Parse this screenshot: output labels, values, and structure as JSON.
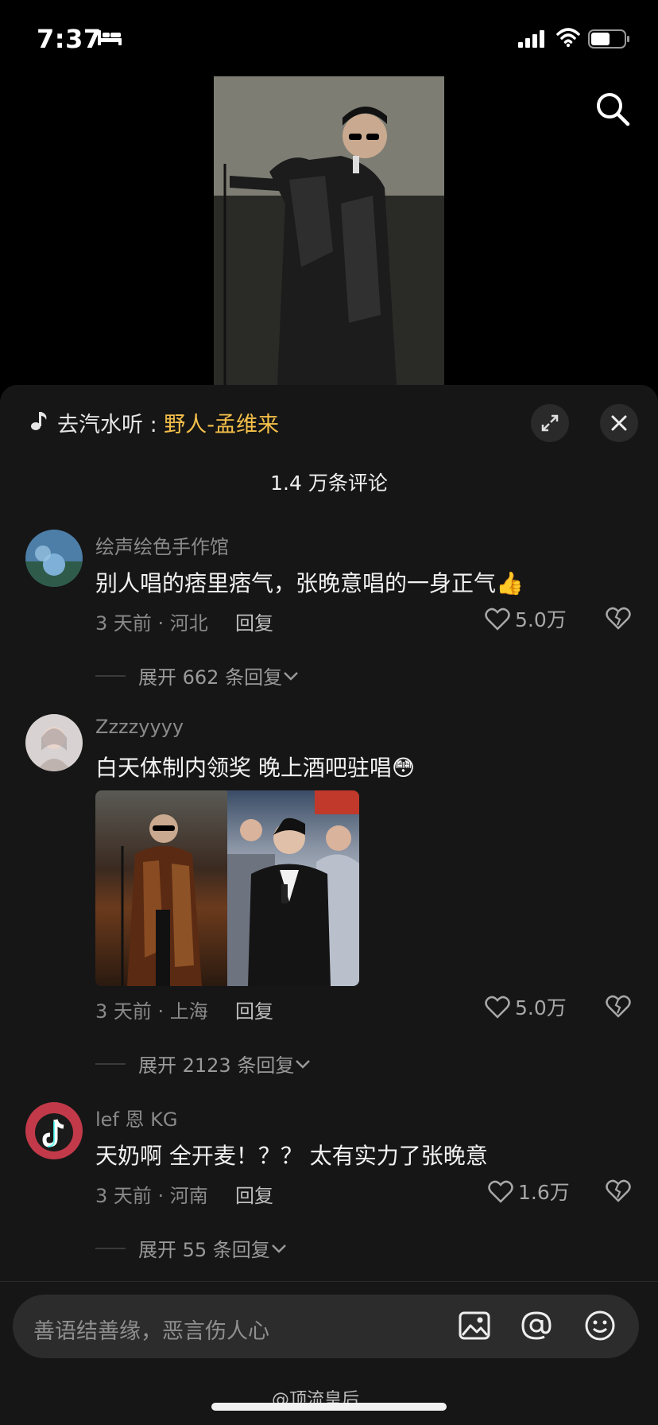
{
  "status_bar": {
    "time": "7:37"
  },
  "sheet": {
    "music": {
      "prefix": "去汽水听 : ",
      "song": "野人-孟维来"
    },
    "comment_count": "1.4 万条评论"
  },
  "comments": [
    {
      "username": "绘声绘色手作馆",
      "text": "别人唱的痞里痞气，张晚意唱的一身正气👍",
      "time_location": "3 天前 · 河北",
      "reply_label": "回复",
      "likes": "5.0万",
      "expand": "展开 662 条回复"
    },
    {
      "username": "Zzzzyyyy",
      "text": "白天体制内领奖 晚上酒吧驻唱😳",
      "time_location": "3 天前 · 上海",
      "reply_label": "回复",
      "likes": "5.0万",
      "expand": "展开 2123 条回复"
    },
    {
      "username": "lef 恩 KG",
      "text": "天奶啊 全开麦！？？ 太有实力了张晚意",
      "time_location": "3 天前 · 河南",
      "reply_label": "回复",
      "likes": "1.6万",
      "expand": "展开 55 条回复"
    }
  ],
  "input": {
    "placeholder": "善语结善缘，恶言伤人心"
  },
  "watermark": "@顶流皇后",
  "colors": {
    "accent_song": "#f5c04a",
    "sheet_bg": "#161616"
  },
  "icons": [
    "bed-icon",
    "signal-icon",
    "wifi-icon",
    "battery-icon",
    "search-icon",
    "music-note-icon",
    "expand-icon",
    "close-icon",
    "heart-icon",
    "broken-heart-icon",
    "chevron-down-icon",
    "image-icon",
    "at-icon",
    "emoji-icon"
  ]
}
